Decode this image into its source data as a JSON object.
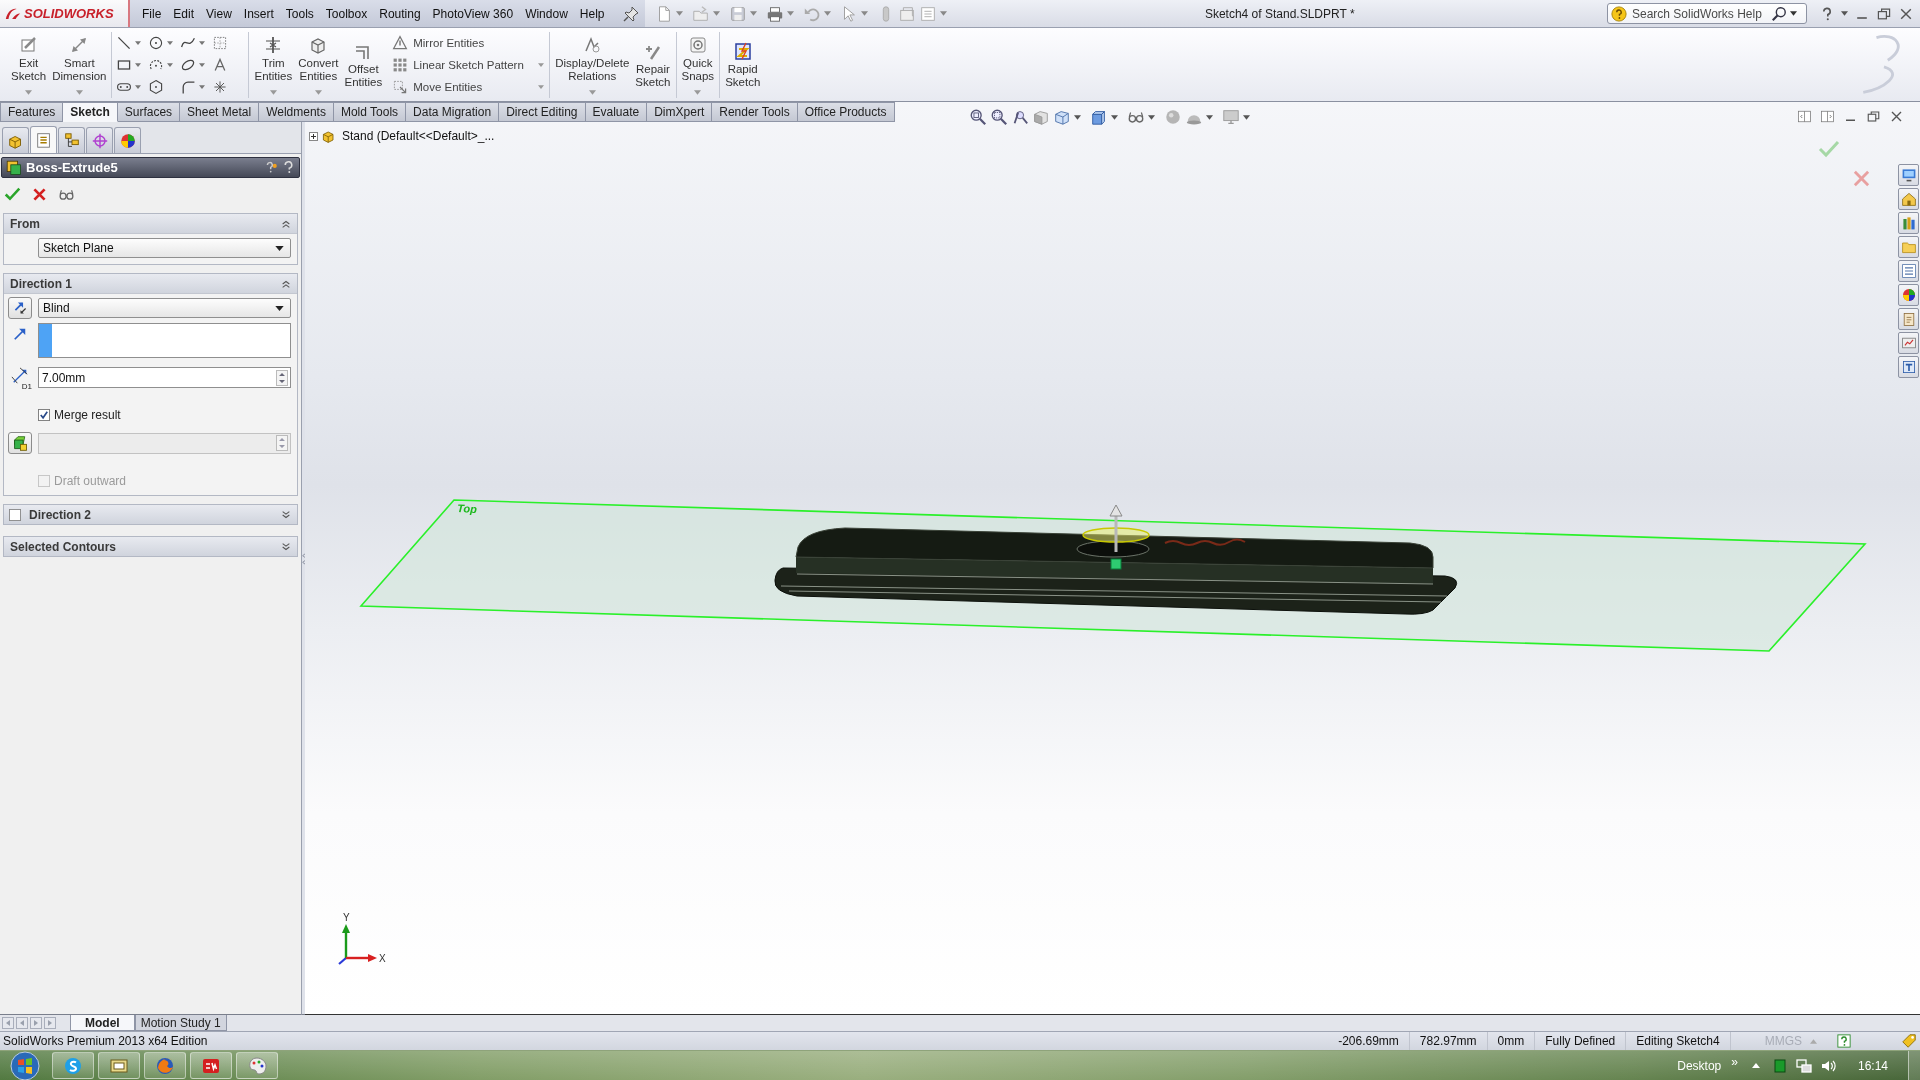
{
  "title_bar": {
    "logo": "SOLIDWORKS",
    "menu": [
      "File",
      "Edit",
      "View",
      "Insert",
      "Tools",
      "Toolbox",
      "Routing",
      "PhotoView 360",
      "Window",
      "Help"
    ],
    "document_title": "Sketch4 of Stand.SLDPRT *",
    "help_search": {
      "placeholder": "Search SolidWorks Help"
    }
  },
  "command_manager": {
    "groups": [
      {
        "kind": "large",
        "tools": [
          {
            "label": "Exit Sketch",
            "dropdown": true
          },
          {
            "label": "Smart Dimension",
            "dropdown": true
          }
        ]
      },
      {
        "kind": "sketch-grid"
      },
      {
        "kind": "large",
        "tools": [
          {
            "label": "Trim Entities",
            "dropdown": true
          },
          {
            "label": "Convert Entities",
            "dropdown": true
          },
          {
            "label": "Offset Entities",
            "dropdown": false
          }
        ]
      },
      {
        "kind": "stack",
        "tools": [
          {
            "label": "Mirror Entities",
            "dropdown": false
          },
          {
            "label": "Linear Sketch Pattern",
            "dropdown": true
          },
          {
            "label": "Move Entities",
            "dropdown": true
          }
        ]
      },
      {
        "kind": "large",
        "tools": [
          {
            "label": "Display/Delete Relations",
            "dropdown": true
          },
          {
            "label": "Repair Sketch",
            "dropdown": false
          }
        ]
      },
      {
        "kind": "large",
        "tools": [
          {
            "label": "Quick Snaps",
            "dropdown": true
          }
        ]
      },
      {
        "kind": "large",
        "tools": [
          {
            "label": "Rapid Sketch",
            "dropdown": false
          }
        ]
      }
    ]
  },
  "tabs": [
    {
      "label": "Features",
      "selected": false
    },
    {
      "label": "Sketch",
      "selected": true
    },
    {
      "label": "Surfaces",
      "selected": false
    },
    {
      "label": "Sheet Metal",
      "selected": false
    },
    {
      "label": "Weldments",
      "selected": false
    },
    {
      "label": "Mold Tools",
      "selected": false
    },
    {
      "label": "Data Migration",
      "selected": false
    },
    {
      "label": "Direct Editing",
      "selected": false
    },
    {
      "label": "Evaluate",
      "selected": false
    },
    {
      "label": "DimXpert",
      "selected": false
    },
    {
      "label": "Render Tools",
      "selected": false
    },
    {
      "label": "Office Products",
      "selected": false
    }
  ],
  "manager_tabs": [
    {
      "selected": false
    },
    {
      "selected": true
    },
    {
      "selected": false
    },
    {
      "selected": false
    },
    {
      "selected": false
    }
  ],
  "property_manager": {
    "title": "Boss-Extrude5",
    "from": {
      "title": "From",
      "expanded": true,
      "start_condition": "Sketch Plane"
    },
    "direction_1": {
      "title": "Direction 1",
      "expanded": true,
      "end_condition": "Blind",
      "reference_active": true,
      "depth": "7.00mm",
      "depth_label": "D1",
      "merge_result": {
        "label": "Merge result",
        "checked": true,
        "disabled": false
      },
      "draft_angle": {
        "disabled": true
      },
      "draft_outward": {
        "label": "Draft outward",
        "checked": false,
        "disabled": true
      }
    },
    "direction_2": {
      "title": "Direction 2",
      "checked": false,
      "expanded": false
    },
    "selected_contours": {
      "title": "Selected Contours",
      "expanded": false
    }
  },
  "graphics_area": {
    "tree_item": {
      "label": "Stand (Default<<Default>_...",
      "expanded": false
    },
    "plane_label": "Top",
    "triad": {
      "y_label": "Y",
      "x_label": "X"
    }
  },
  "bottom_tabs": [
    {
      "label": "Model",
      "selected": true
    },
    {
      "label": "Motion Study 1",
      "selected": false
    }
  ],
  "status_bar": {
    "product": "SolidWorks Premium 2013 x64 Edition",
    "readouts": [
      "-206.69mm",
      "782.97mm",
      "0mm",
      "Fully Defined",
      "Editing Sketch4"
    ],
    "units": {
      "label": "MMGS",
      "disabled": true
    }
  },
  "taskbar": {
    "toolbar_label": "Desktop",
    "overflow": "»",
    "clock": "16:14"
  }
}
